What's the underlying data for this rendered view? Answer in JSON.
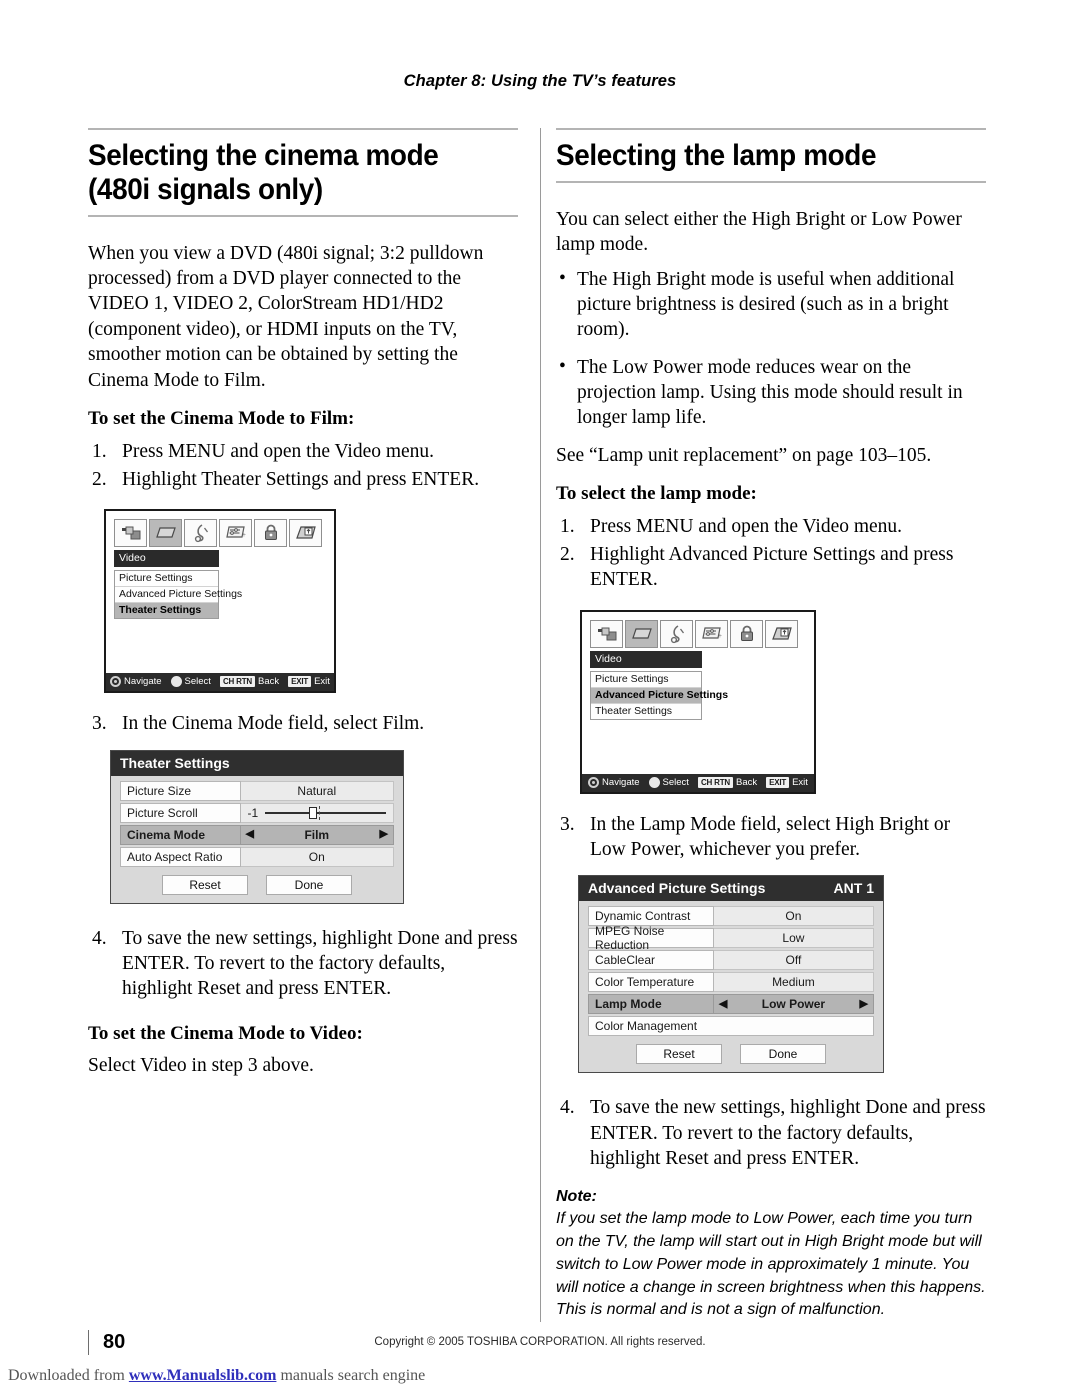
{
  "header": {
    "chapter": "Chapter 8: Using the TV’s features"
  },
  "left_column": {
    "title_line1": "Selecting the cinema mode",
    "title_line2": "(480i signals only)",
    "intro": "When you view a DVD (480i signal; 3:2 pulldown processed) from a DVD player connected to the VIDEO 1, VIDEO 2, ColorStream HD1/HD2 (component video), or HDMI inputs on the TV, smoother motion can be obtained by setting the Cinema Mode to Film.",
    "subhead_film": "To set the Cinema Mode to Film:",
    "steps": [
      {
        "num": "1.",
        "text": "Press MENU and open the Video menu."
      },
      {
        "num": "2.",
        "text": "Highlight Theater Settings and press ENTER."
      },
      {
        "num": "3.",
        "text": "In the Cinema Mode field, select Film."
      },
      {
        "num": "4.",
        "text": "To save the new settings, highlight Done and press ENTER. To revert to the factory defaults, highlight Reset and press ENTER."
      }
    ],
    "subhead_video": "To set the Cinema Mode to Video:",
    "video_text": "Select Video in step 3 above.",
    "menu_screenshot": {
      "icons": [
        "setup-icon",
        "video-icon",
        "audio-icon",
        "preferences-icon",
        "lock-icon",
        "tv-icon"
      ],
      "selected_icon_index": 1,
      "menu_title": "Video",
      "items": [
        {
          "label": "Picture Settings",
          "highlighted": false
        },
        {
          "label": "Advanced Picture Settings",
          "highlighted": false
        },
        {
          "label": "Theater Settings",
          "highlighted": true
        }
      ],
      "footbar": [
        {
          "key": "",
          "icon": "dpad-ring",
          "label": "Navigate"
        },
        {
          "key": "",
          "icon": "enter-ring",
          "label": "Select"
        },
        {
          "key": "CH RTN",
          "icon": "",
          "label": "Back"
        },
        {
          "key": "EXIT",
          "icon": "",
          "label": "Exit"
        }
      ]
    },
    "theater_dialog": {
      "title": "Theater Settings",
      "rows": [
        {
          "label": "Picture Size",
          "value": "Natural",
          "type": "value",
          "active": false
        },
        {
          "label": "Picture Scroll",
          "value": "-1",
          "type": "slider",
          "active": false
        },
        {
          "label": "Cinema Mode",
          "value": "Film",
          "type": "value",
          "active": true
        },
        {
          "label": "Auto Aspect Ratio",
          "value": "On",
          "type": "value",
          "active": false
        }
      ],
      "buttons": {
        "reset": "Reset",
        "done": "Done"
      }
    }
  },
  "right_column": {
    "title": "Selecting the lamp mode",
    "intro": "You can select either the High Bright or Low Power lamp mode.",
    "bullets": [
      "The High Bright mode is useful when additional picture brightness is desired (such as in a bright room).",
      "The Low Power mode reduces wear on the projection lamp. Using this mode should result in longer lamp life."
    ],
    "see_also": "See “Lamp unit replacement” on page 103–105.",
    "subhead_lamp": "To select the lamp mode:",
    "steps": [
      {
        "num": "1.",
        "text": "Press MENU and open the Video menu."
      },
      {
        "num": "2.",
        "text": "Highlight Advanced Picture Settings and press ENTER."
      },
      {
        "num": "3.",
        "text": "In the Lamp Mode field, select High Bright or Low Power, whichever you prefer."
      },
      {
        "num": "4.",
        "text": "To save the new settings, highlight Done and press ENTER. To revert to the factory defaults, highlight Reset and press ENTER."
      }
    ],
    "menu_screenshot": {
      "icons": [
        "setup-icon",
        "video-icon",
        "audio-icon",
        "preferences-icon",
        "lock-icon",
        "tv-icon"
      ],
      "selected_icon_index": 1,
      "menu_title": "Video",
      "items": [
        {
          "label": "Picture Settings",
          "highlighted": false
        },
        {
          "label": "Advanced Picture Settings",
          "highlighted": true
        },
        {
          "label": "Theater Settings",
          "highlighted": false
        }
      ],
      "footbar": [
        {
          "key": "",
          "icon": "dpad-ring",
          "label": "Navigate"
        },
        {
          "key": "",
          "icon": "enter-ring",
          "label": "Select"
        },
        {
          "key": "CH RTN",
          "icon": "",
          "label": "Back"
        },
        {
          "key": "EXIT",
          "icon": "",
          "label": "Exit"
        }
      ]
    },
    "advanced_dialog": {
      "title": "Advanced Picture Settings",
      "source_badge": "ANT 1",
      "rows": [
        {
          "label": "Dynamic Contrast",
          "value": "On",
          "active": false
        },
        {
          "label": "MPEG Noise Reduction",
          "value": "Low",
          "active": false
        },
        {
          "label": "CableClear",
          "value": "Off",
          "active": false
        },
        {
          "label": "Color Temperature",
          "value": "Medium",
          "active": false
        },
        {
          "label": "Lamp Mode",
          "value": "Low Power",
          "active": true
        },
        {
          "label": "Color Management",
          "value": "",
          "active": false
        }
      ],
      "buttons": {
        "reset": "Reset",
        "done": "Done"
      }
    },
    "note": {
      "label": "Note:",
      "text": "If you set the lamp mode to Low Power, each time you turn on the TV, the lamp will start out in High Bright mode but will switch to Low Power mode in approximately 1 minute. You will notice a change in screen brightness when this happens. This is normal and is not a sign of malfunction."
    }
  },
  "footer": {
    "page_number": "80",
    "copyright": "Copyright © 2005 TOSHIBA CORPORATION. All rights reserved.",
    "download_prefix": "Downloaded from ",
    "download_link": "www.Manualslib.com",
    "download_suffix": " manuals search engine"
  },
  "colors": {
    "rule": "#b4b4b4",
    "osd_title_bg": "#2a2a2a",
    "osd_highlight": "#b5b5b5",
    "link": "#2f2fbb"
  }
}
